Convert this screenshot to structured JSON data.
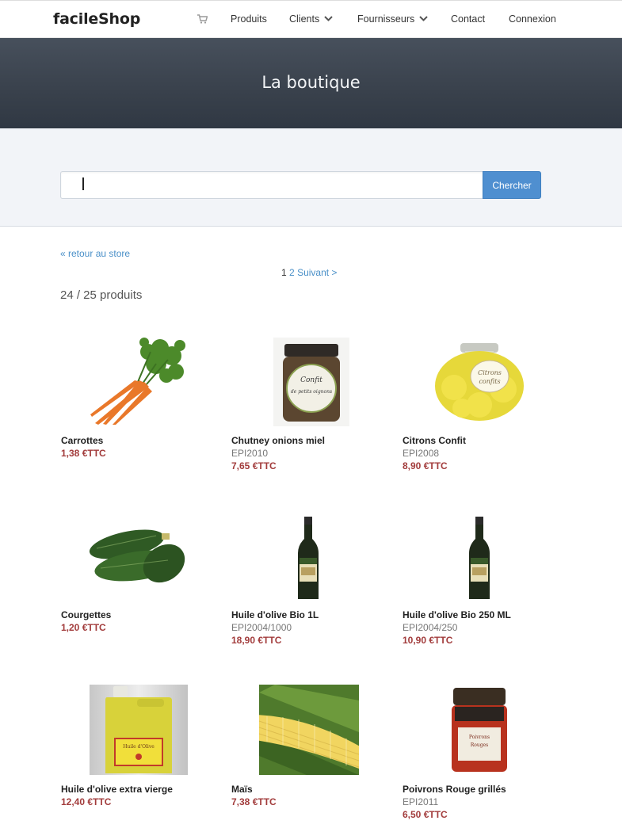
{
  "navbar": {
    "brand": "facileShop",
    "items": [
      {
        "label": "Produits"
      },
      {
        "label": "Clients"
      },
      {
        "label": "Fournisseurs"
      },
      {
        "label": "Contact"
      },
      {
        "label": "Connexion"
      }
    ]
  },
  "hero": {
    "title": "La boutique"
  },
  "search": {
    "value": "",
    "button_label": "Chercher"
  },
  "content": {
    "back_link": "« retour au store",
    "pagination": {
      "current": "1",
      "page2": "2",
      "next": "Suivant >"
    },
    "count": "24 / 25 produits"
  },
  "products": [
    {
      "name": "Carrottes",
      "ref": "",
      "price": "1,38 €TTC"
    },
    {
      "name": "Chutney onions miel",
      "ref": "EPI2010",
      "price": "7,65 €TTC"
    },
    {
      "name": "Citrons Confit",
      "ref": "EPI2008",
      "price": "8,90 €TTC"
    },
    {
      "name": "Courgettes",
      "ref": "",
      "price": "1,20 €TTC"
    },
    {
      "name": "Huile d'olive Bio 1L",
      "ref": "EPI2004/1000",
      "price": "18,90 €TTC"
    },
    {
      "name": "Huile d'olive Bio 250 ML",
      "ref": "EPI2004/250",
      "price": "10,90 €TTC"
    },
    {
      "name": "Huile d'olive extra vierge",
      "ref": "",
      "price": "12,40 €TTC"
    },
    {
      "name": "Maïs",
      "ref": "",
      "price": "7,38 €TTC"
    },
    {
      "name": "Poivrons Rouge grillés",
      "ref": "EPI2011",
      "price": "6,50 €TTC"
    }
  ],
  "images": {
    "jar_label_1": "Confit",
    "jar_label_2": "de petits oignons",
    "citron_label_1": "Citrons",
    "citron_label_2": "confits",
    "oil_label": "Huile d'Olive",
    "pepper_label_1": "Poivrons",
    "pepper_label_2": "Rouges"
  },
  "colors": {
    "accent": "#4f8fd0",
    "price": "#a23c3c",
    "link": "#4a90c8"
  }
}
